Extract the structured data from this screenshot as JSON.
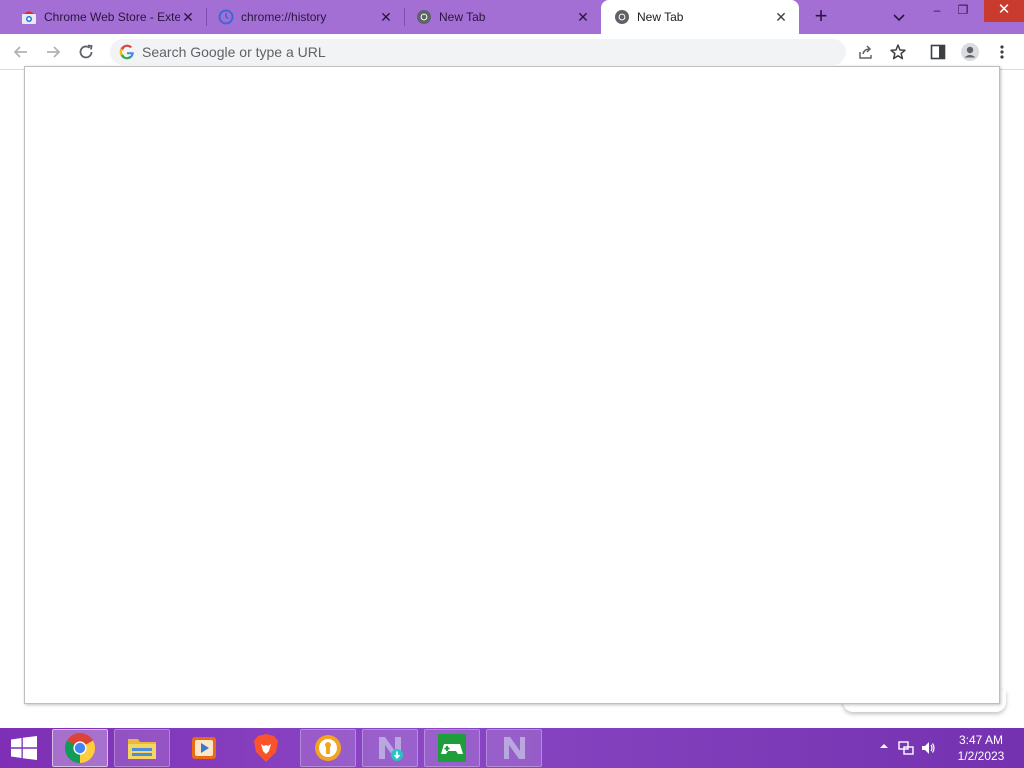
{
  "browser": {
    "tabs": [
      {
        "title": "Chrome Web Store - Exte",
        "favicon": "chrome-web-store-icon",
        "active": false
      },
      {
        "title": "chrome://history",
        "favicon": "history-icon",
        "active": false
      },
      {
        "title": "New Tab",
        "favicon": "chrome-icon",
        "active": false
      },
      {
        "title": "New Tab",
        "favicon": "chrome-icon",
        "active": true
      }
    ],
    "new_tab_symbol": "+",
    "close_symbol": "✕",
    "window_controls": {
      "minimize": "–",
      "restore": "❐",
      "close": "✕"
    }
  },
  "toolbar": {
    "omnibox_placeholder": "Search Google or type a URL",
    "omnibox_value": ""
  },
  "taskbar": {
    "apps": [
      {
        "name": "Google Chrome",
        "icon": "chrome-icon",
        "state": "running"
      },
      {
        "name": "File Explorer",
        "icon": "file-explorer-icon",
        "state": "pinned"
      },
      {
        "name": "Media Player",
        "icon": "media-player-icon",
        "state": "none"
      },
      {
        "name": "Brave",
        "icon": "brave-icon",
        "state": "none"
      },
      {
        "name": "Security App",
        "icon": "lock-badge-icon",
        "state": "pinned"
      },
      {
        "name": "Installer",
        "icon": "installer-icon",
        "state": "pinned"
      },
      {
        "name": "Game",
        "icon": "gamepad-icon",
        "state": "pinned"
      },
      {
        "name": "N App",
        "icon": "n-logo-icon",
        "state": "pinned"
      }
    ],
    "clock": {
      "time": "3:47 AM",
      "date": "1/2/2023"
    }
  },
  "colors": {
    "tabstrip": "#a46fd4",
    "taskbar": "#7e2fb5",
    "close_red": "#c93b2f"
  }
}
